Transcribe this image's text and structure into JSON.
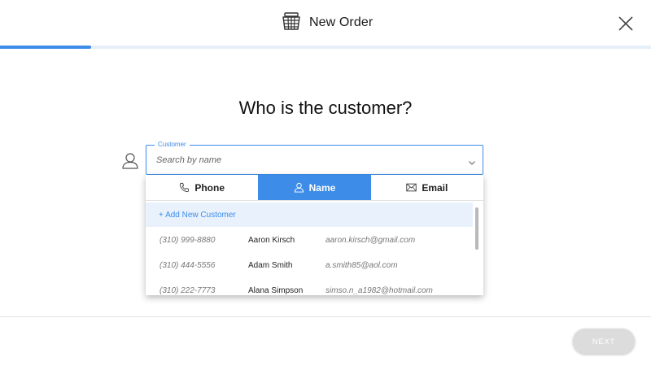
{
  "header": {
    "title": "New Order",
    "icon": "basket-icon",
    "close_icon": "close-icon"
  },
  "progress": {
    "fraction": 0.14,
    "color": "#3d8ce8",
    "track_color": "#e6eef8"
  },
  "question": "Who is the customer?",
  "customer_field": {
    "legend": "Customer",
    "placeholder": "Search by name",
    "value": "",
    "leading_icon": "person-icon",
    "trailing_icon": "chevron-down-icon"
  },
  "search_tabs": [
    {
      "label": "Phone",
      "icon": "phone-icon",
      "active": false
    },
    {
      "label": "Name",
      "icon": "person-icon",
      "active": true
    },
    {
      "label": "Email",
      "icon": "envelope-icon",
      "active": false
    }
  ],
  "add_new_label": "+ Add New Customer",
  "customers": [
    {
      "phone": "(310) 999-8880",
      "name": "Aaron Kirsch",
      "email": "aaron.kirsch@gmail.com"
    },
    {
      "phone": "(310) 444-5556",
      "name": "Adam Smith",
      "email": "a.smith85@aol.com"
    },
    {
      "phone": "(310) 222-7773",
      "name": "Alana Simpson",
      "email": "simso.n_a1982@hotmail.com"
    }
  ],
  "next_button": {
    "label": "NEXT",
    "enabled": false
  },
  "colors": {
    "accent": "#3d8ce8",
    "highlight_row": "#e9f2fc",
    "disabled_button": "#dcdcdc"
  }
}
